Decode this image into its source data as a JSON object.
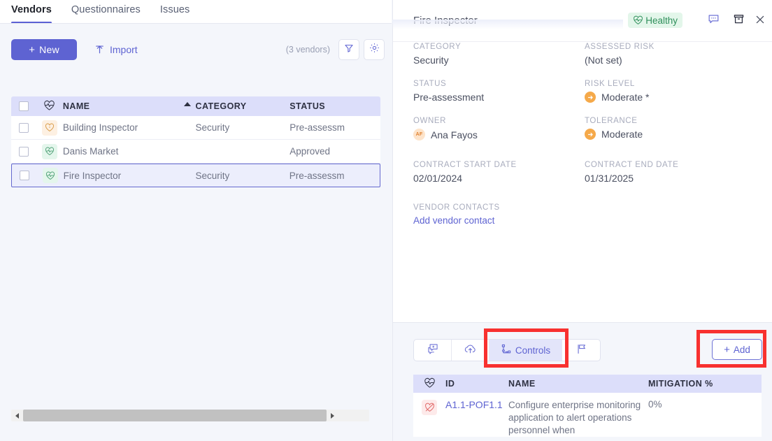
{
  "nav": {
    "tabs": [
      {
        "label": "Vendors",
        "active": true
      },
      {
        "label": "Questionnaires",
        "active": false
      },
      {
        "label": "Issues",
        "active": false
      }
    ]
  },
  "toolbar": {
    "new_label": "New",
    "new_plus": "+",
    "import_label": "Import",
    "import_icon": "upload-icon",
    "count_label": "(3 vendors)",
    "filter_icon": "filter-icon",
    "gear_icon": "gear-icon"
  },
  "vendor_grid": {
    "columns": {
      "health": "health-icon",
      "name": "NAME",
      "category": "CATEGORY",
      "status": "STATUS"
    },
    "sorted_by": "CATEGORY",
    "sort_direction": "ascending",
    "rows": [
      {
        "health": "heart-outline-icon",
        "health_color": "#e0a44a",
        "name": "Building Inspector",
        "category": "Security",
        "status": "Pre-assessm",
        "selected": false
      },
      {
        "health": "heart-pulse-icon",
        "health_color": "#4a9e73",
        "name": "Danis Market",
        "category": "",
        "status": "Approved",
        "selected": false
      },
      {
        "health": "heart-pulse-icon",
        "health_color": "#4a9e73",
        "name": "Fire Inspector",
        "category": "Security",
        "status": "Pre-assessm",
        "selected": true
      }
    ]
  },
  "scrollbar": {
    "left_arrow_icon": "triangle-left-icon",
    "right_arrow_icon": "triangle-right-icon"
  },
  "detail": {
    "title": "Fire Inspector",
    "status_badge": "Healthy",
    "status_badge_icon": "heart-pulse-icon",
    "status_badge_color": "#2f8f5b",
    "comment_icon": "comment-icon",
    "archive_icon": "archive-icon",
    "close_icon": "close-icon",
    "fields": [
      {
        "label": "CATEGORY",
        "value": "Security",
        "icon": null
      },
      {
        "label": "ASSESSED RISK",
        "value": "(Not set)",
        "icon": null
      },
      {
        "label": "STATUS",
        "value": "Pre-assessment",
        "icon": null
      },
      {
        "label": "RISK LEVEL",
        "value": "Moderate *",
        "icon": "arrow-right-badge"
      },
      {
        "label": "OWNER",
        "value": "Ana Fayos",
        "icon": "avatar",
        "initials": "AF"
      },
      {
        "label": "TOLERANCE",
        "value": "Moderate",
        "icon": "arrow-right-badge"
      },
      {
        "label": "CONTRACT START DATE",
        "value": "02/01/2024",
        "icon": null
      },
      {
        "label": "CONTRACT END DATE",
        "value": "01/31/2025",
        "icon": null
      }
    ],
    "vendor_contacts": {
      "label": "VENDOR CONTACTS",
      "link": "Add vendor contact"
    }
  },
  "lower": {
    "segments": [
      {
        "icon": "questionnaire-icon",
        "label": "",
        "active": false
      },
      {
        "icon": "cloud-upload-icon",
        "label": "",
        "active": false
      },
      {
        "icon": "controls-icon",
        "label": "Controls",
        "active": true
      },
      {
        "icon": "flag-icon",
        "label": "",
        "active": false
      }
    ],
    "add_button": {
      "plus": "+",
      "label": "Add"
    },
    "controls_table": {
      "columns": {
        "health": "health-icon",
        "id": "ID",
        "name": "NAME",
        "mitigation": "MITIGATION %"
      },
      "rows": [
        {
          "health": "heart-slash-icon",
          "id": "A1.1-POF1.1",
          "name": "Configure enterprise monitoring application to alert operations personnel when",
          "mitigation": "0%"
        }
      ]
    }
  },
  "annotations": {
    "controls_highlight": "red-rect-controls-tab",
    "add_highlight": "red-rect-add-button",
    "color": "#f8312f"
  }
}
